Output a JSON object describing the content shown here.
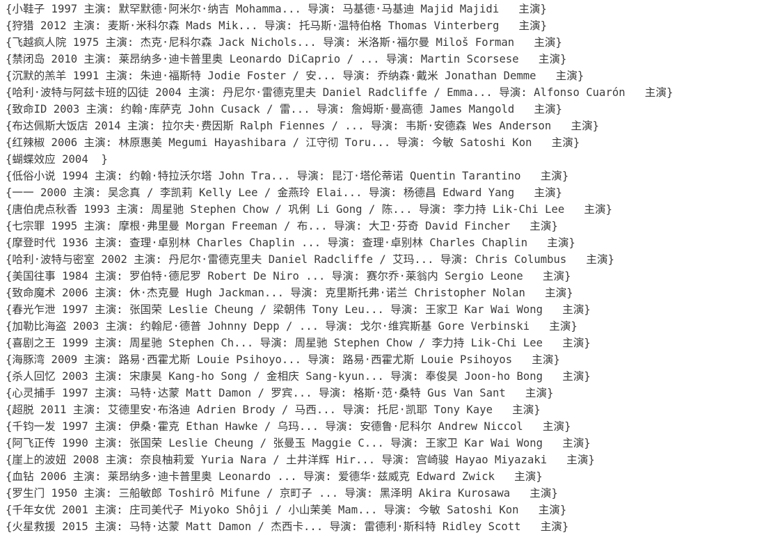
{
  "lines": [
    "{小鞋子 1997 主演: 默罕默德·阿米尔·纳吉 Mohamma... 导演: 马基德·马基迪 Majid Majidi   主演}",
    "{狩猎 2012 主演: 麦斯·米科尔森 Mads Mik... 导演: 托马斯·温特伯格 Thomas Vinterberg   主演}",
    "{飞越疯人院 1975 主演: 杰克·尼科尔森 Jack Nichols... 导演: 米洛斯·福尔曼 Miloš Forman   主演}",
    "{禁闭岛 2010 主演: 莱昂纳多·迪卡普里奥 Leonardo DiCaprio / ... 导演: Martin Scorsese   主演}",
    "{沉默的羔羊 1991 主演: 朱迪·福斯特 Jodie Foster / 安... 导演: 乔纳森·戴米 Jonathan Demme   主演}",
    "{哈利·波特与阿兹卡班的囚徒 2004 主演: 丹尼尔·雷德克里夫 Daniel Radcliffe / Emma... 导演: Alfonso Cuarón   主演}",
    "{致命ID 2003 主演: 约翰·库萨克 John Cusack / 雷... 导演: 詹姆斯·曼高德 James Mangold   主演}",
    "{布达佩斯大饭店 2014 主演: 拉尔夫·费因斯 Ralph Fiennes / ... 导演: 韦斯·安德森 Wes Anderson   主演}",
    "{红辣椒 2006 主演: 林原惠美 Megumi Hayashibara / 江守彻 Toru... 导演: 今敏 Satoshi Kon   主演}",
    "{蝴蝶效应 2004  }",
    "{低俗小说 1994 主演: 约翰·特拉沃尔塔 John Tra... 导演: 昆汀·塔伦蒂诺 Quentin Tarantino   主演}",
    "{一一 2000 主演: 吴念真 / 李凯莉 Kelly Lee / 金燕玲 Elai... 导演: 杨德昌 Edward Yang   主演}",
    "{唐伯虎点秋香 1993 主演: 周星驰 Stephen Chow / 巩俐 Li Gong / 陈... 导演: 李力持 Lik-Chi Lee   主演}",
    "{七宗罪 1995 主演: 摩根·弗里曼 Morgan Freeman / 布... 导演: 大卫·芬奇 David Fincher   主演}",
    "{摩登时代 1936 主演: 查理·卓别林 Charles Chaplin ... 导演: 查理·卓别林 Charles Chaplin   主演}",
    "{哈利·波特与密室 2002 主演: 丹尼尔·雷德克里夫 Daniel Radcliffe / 艾玛... 导演: Chris Columbus   主演}",
    "{美国往事 1984 主演: 罗伯特·德尼罗 Robert De Niro ... 导演: 赛尔乔·莱翁内 Sergio Leone   主演}",
    "{致命魔术 2006 主演: 休·杰克曼 Hugh Jackman... 导演: 克里斯托弗·诺兰 Christopher Nolan   主演}",
    "{春光乍泄 1997 主演: 张国荣 Leslie Cheung / 梁朝伟 Tony Leu... 导演: 王家卫 Kar Wai Wong   主演}",
    "{加勒比海盗 2003 主演: 约翰尼·德普 Johnny Depp / ... 导演: 戈尔·维宾斯基 Gore Verbinski   主演}",
    "{喜剧之王 1999 主演: 周星驰 Stephen Ch... 导演: 周星驰 Stephen Chow / 李力持 Lik-Chi Lee   主演}",
    "{海豚湾 2009 主演: 路易·西霍尤斯 Louie Psihoyo... 导演: 路易·西霍尤斯 Louie Psihoyos   主演}",
    "{杀人回忆 2003 主演: 宋康昊 Kang-ho Song / 金相庆 Sang-kyun... 导演: 奉俊昊 Joon-ho Bong   主演}",
    "{心灵捕手 1997 主演: 马特·达蒙 Matt Damon / 罗宾... 导演: 格斯·范·桑特 Gus Van Sant   主演}",
    "{超脱 2011 主演: 艾德里安·布洛迪 Adrien Brody / 马西... 导演: 托尼·凯耶 Tony Kaye   主演}",
    "{千钧一发 1997 主演: 伊桑·霍克 Ethan Hawke / 乌玛... 导演: 安德鲁·尼科尔 Andrew Niccol   主演}",
    "{阿飞正传 1990 主演: 张国荣 Leslie Cheung / 张曼玉 Maggie C... 导演: 王家卫 Kar Wai Wong   主演}",
    "{崖上的波妞 2008 主演: 奈良柚莉爱 Yuria Nara / 土井洋辉 Hir... 导演: 宫崎骏 Hayao Miyazaki   主演}",
    "{血钻 2006 主演: 莱昂纳多·迪卡普里奥 Leonardo ... 导演: 爱德华·兹威克 Edward Zwick   主演}",
    "{罗生门 1950 主演: 三船敏郎 Toshirô Mifune / 京町子 ... 导演: 黑泽明 Akira Kurosawa   主演}",
    "{千年女优 2001 主演: 庄司美代子 Miyoko Shôji / 小山茉美 Mam... 导演: 今敏 Satoshi Kon   主演}",
    "{火星救援 2015 主演: 马特·达蒙 Matt Damon / 杰西卡... 导演: 雷德利·斯科特 Ridley Scott   主演}"
  ]
}
